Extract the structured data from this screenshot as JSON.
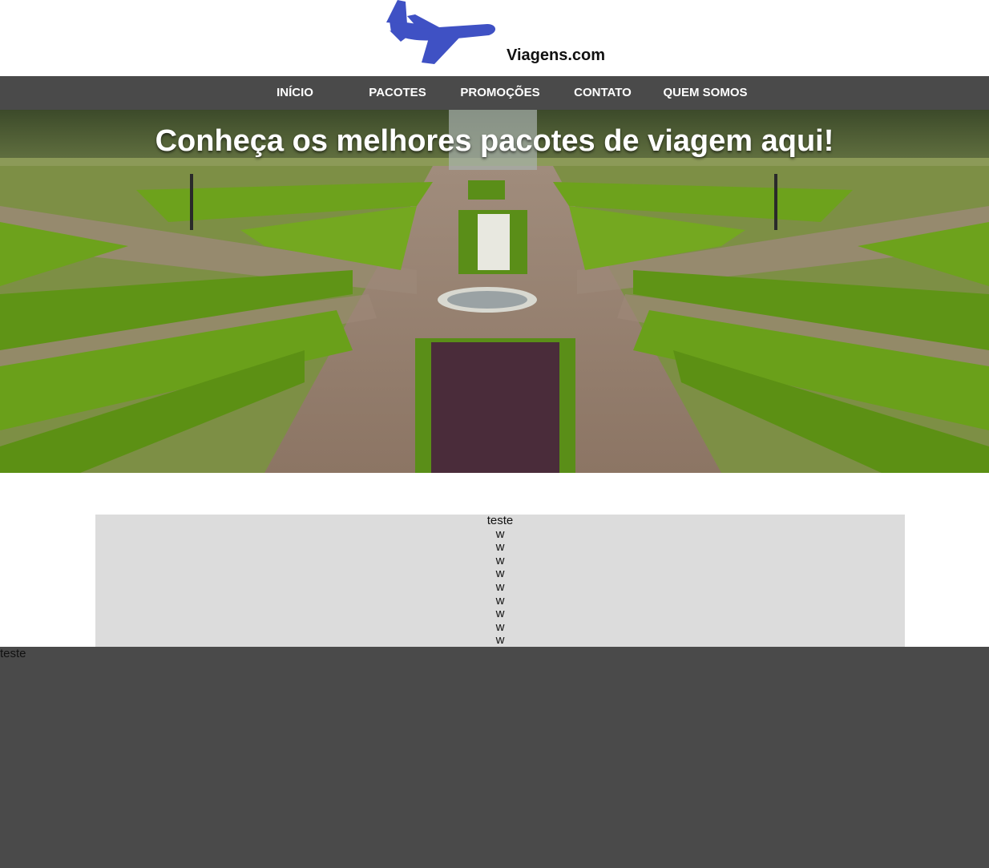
{
  "header": {
    "logo_icon": "airplane-icon",
    "logo_color": "#3f51c4",
    "logo_text": "Viagens.com"
  },
  "nav": {
    "background": "#4a4a4a",
    "items": [
      {
        "label": "INÍCIO"
      },
      {
        "label": "PACOTES"
      },
      {
        "label": "PROMOÇÕES"
      },
      {
        "label": "CONTATO"
      },
      {
        "label": "QUEM SOMOS"
      }
    ]
  },
  "hero": {
    "title": "Conheça os melhores pacotes de viagem aqui!"
  },
  "content": {
    "background": "#dcdcdc",
    "lines": [
      "teste",
      "w",
      "w",
      "w",
      "w",
      "w",
      "w",
      "w",
      "w",
      "w"
    ]
  },
  "footer": {
    "background": "#4a4a4a",
    "text": "teste"
  }
}
